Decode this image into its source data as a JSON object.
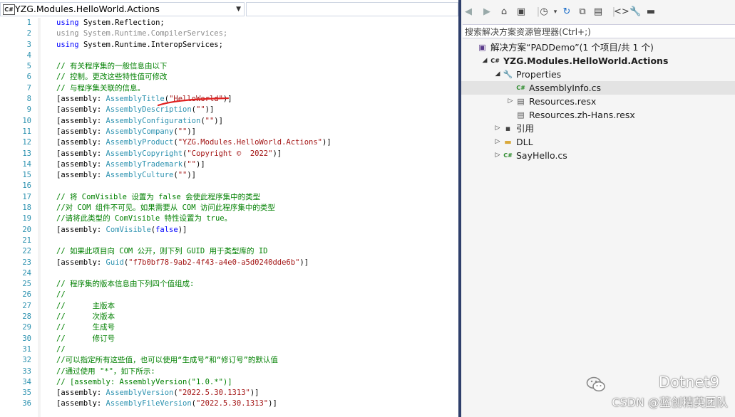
{
  "editor": {
    "type_combo": "YZG.Modules.HelloWorld.Actions",
    "lines": [
      {
        "n": "1",
        "parts": [
          {
            "t": "using ",
            "c": "kw"
          },
          {
            "t": "System.Reflection;",
            "c": ""
          }
        ]
      },
      {
        "n": "2",
        "parts": [
          {
            "t": "using System.Runtime.CompilerServices;",
            "c": "dim"
          }
        ]
      },
      {
        "n": "3",
        "parts": [
          {
            "t": "using ",
            "c": "kw"
          },
          {
            "t": "System.Runtime.InteropServices;",
            "c": ""
          }
        ]
      },
      {
        "n": "4",
        "parts": []
      },
      {
        "n": "5",
        "parts": [
          {
            "t": "// 有关程序集的一般信息由以下",
            "c": "cm"
          }
        ]
      },
      {
        "n": "6",
        "parts": [
          {
            "t": "// 控制。更改这些特性值可修改",
            "c": "cm"
          }
        ]
      },
      {
        "n": "7",
        "parts": [
          {
            "t": "// 与程序集关联的信息。",
            "c": "cm"
          }
        ]
      },
      {
        "n": "8",
        "parts": [
          {
            "t": "[assembly: ",
            "c": ""
          },
          {
            "t": "AssemblyTitle",
            "c": "ty"
          },
          {
            "t": "(",
            "c": ""
          },
          {
            "t": "\"HelloWorld\"",
            "c": "str"
          },
          {
            "t": ")]",
            "c": ""
          }
        ]
      },
      {
        "n": "9",
        "parts": [
          {
            "t": "[assembly: ",
            "c": ""
          },
          {
            "t": "AssemblyDescription",
            "c": "ty"
          },
          {
            "t": "(",
            "c": ""
          },
          {
            "t": "\"\"",
            "c": "str"
          },
          {
            "t": ")]",
            "c": ""
          }
        ]
      },
      {
        "n": "10",
        "parts": [
          {
            "t": "[assembly: ",
            "c": ""
          },
          {
            "t": "AssemblyConfiguration",
            "c": "ty"
          },
          {
            "t": "(",
            "c": ""
          },
          {
            "t": "\"\"",
            "c": "str"
          },
          {
            "t": ")]",
            "c": ""
          }
        ]
      },
      {
        "n": "11",
        "parts": [
          {
            "t": "[assembly: ",
            "c": ""
          },
          {
            "t": "AssemblyCompany",
            "c": "ty"
          },
          {
            "t": "(",
            "c": ""
          },
          {
            "t": "\"\"",
            "c": "str"
          },
          {
            "t": ")]",
            "c": ""
          }
        ]
      },
      {
        "n": "12",
        "parts": [
          {
            "t": "[assembly: ",
            "c": ""
          },
          {
            "t": "AssemblyProduct",
            "c": "ty"
          },
          {
            "t": "(",
            "c": ""
          },
          {
            "t": "\"YZG.Modules.HelloWorld.Actions\"",
            "c": "str"
          },
          {
            "t": ")]",
            "c": ""
          }
        ]
      },
      {
        "n": "13",
        "parts": [
          {
            "t": "[assembly: ",
            "c": ""
          },
          {
            "t": "AssemblyCopyright",
            "c": "ty"
          },
          {
            "t": "(",
            "c": ""
          },
          {
            "t": "\"Copyright ©  2022\"",
            "c": "str"
          },
          {
            "t": ")]",
            "c": ""
          }
        ]
      },
      {
        "n": "14",
        "parts": [
          {
            "t": "[assembly: ",
            "c": ""
          },
          {
            "t": "AssemblyTrademark",
            "c": "ty"
          },
          {
            "t": "(",
            "c": ""
          },
          {
            "t": "\"\"",
            "c": "str"
          },
          {
            "t": ")]",
            "c": ""
          }
        ]
      },
      {
        "n": "15",
        "parts": [
          {
            "t": "[assembly: ",
            "c": ""
          },
          {
            "t": "AssemblyCulture",
            "c": "ty"
          },
          {
            "t": "(",
            "c": ""
          },
          {
            "t": "\"\"",
            "c": "str"
          },
          {
            "t": ")]",
            "c": ""
          }
        ]
      },
      {
        "n": "16",
        "parts": []
      },
      {
        "n": "17",
        "parts": [
          {
            "t": "// 将 ComVisible 设置为 false 会使此程序集中的类型",
            "c": "cm"
          }
        ]
      },
      {
        "n": "18",
        "parts": [
          {
            "t": "//对 COM 组件不可见。如果需要从 COM 访问此程序集中的类型",
            "c": "cm"
          }
        ]
      },
      {
        "n": "19",
        "parts": [
          {
            "t": "//请将此类型的 ComVisible 特性设置为 true。",
            "c": "cm"
          }
        ]
      },
      {
        "n": "20",
        "parts": [
          {
            "t": "[assembly: ",
            "c": ""
          },
          {
            "t": "ComVisible",
            "c": "ty"
          },
          {
            "t": "(",
            "c": ""
          },
          {
            "t": "false",
            "c": "kw"
          },
          {
            "t": ")]",
            "c": ""
          }
        ]
      },
      {
        "n": "21",
        "parts": []
      },
      {
        "n": "22",
        "parts": [
          {
            "t": "// 如果此项目向 COM 公开，则下列 GUID 用于类型库的 ID",
            "c": "cm"
          }
        ]
      },
      {
        "n": "23",
        "parts": [
          {
            "t": "[assembly: ",
            "c": ""
          },
          {
            "t": "Guid",
            "c": "ty"
          },
          {
            "t": "(",
            "c": ""
          },
          {
            "t": "\"f7b0bf78-9ab2-4f43-a4e0-a5d0240dde6b\"",
            "c": "str"
          },
          {
            "t": ")]",
            "c": ""
          }
        ]
      },
      {
        "n": "24",
        "parts": []
      },
      {
        "n": "25",
        "parts": [
          {
            "t": "// 程序集的版本信息由下列四个值组成:",
            "c": "cm"
          }
        ]
      },
      {
        "n": "26",
        "parts": [
          {
            "t": "//",
            "c": "cm"
          }
        ]
      },
      {
        "n": "27",
        "parts": [
          {
            "t": "//      主版本",
            "c": "cm"
          }
        ]
      },
      {
        "n": "28",
        "parts": [
          {
            "t": "//      次版本",
            "c": "cm"
          }
        ]
      },
      {
        "n": "29",
        "parts": [
          {
            "t": "//      生成号",
            "c": "cm"
          }
        ]
      },
      {
        "n": "30",
        "parts": [
          {
            "t": "//      修订号",
            "c": "cm"
          }
        ]
      },
      {
        "n": "31",
        "parts": [
          {
            "t": "//",
            "c": "cm"
          }
        ]
      },
      {
        "n": "32",
        "parts": [
          {
            "t": "//可以指定所有这些值，也可以使用“生成号”和“修订号”的默认值",
            "c": "cm"
          }
        ]
      },
      {
        "n": "33",
        "parts": [
          {
            "t": "//通过使用 \"*\"，如下所示:",
            "c": "cm"
          }
        ]
      },
      {
        "n": "34",
        "parts": [
          {
            "t": "// [assembly: AssemblyVersion(\"1.0.*\")]",
            "c": "cm"
          }
        ]
      },
      {
        "n": "35",
        "parts": [
          {
            "t": "[assembly: ",
            "c": ""
          },
          {
            "t": "AssemblyVersion",
            "c": "ty"
          },
          {
            "t": "(",
            "c": ""
          },
          {
            "t": "\"2022.5.30.1313\"",
            "c": "str"
          },
          {
            "t": ")]",
            "c": ""
          }
        ]
      },
      {
        "n": "36",
        "parts": [
          {
            "t": "[assembly: ",
            "c": ""
          },
          {
            "t": "AssemblyFileVersion",
            "c": "ty"
          },
          {
            "t": "(",
            "c": ""
          },
          {
            "t": "\"2022.5.30.1313\"",
            "c": "str"
          },
          {
            "t": ")]",
            "c": ""
          }
        ]
      }
    ]
  },
  "explorer": {
    "search_placeholder": "搜索解决方案资源管理器(Ctrl+;)",
    "tree": [
      {
        "name": "solution-node",
        "label": "解决方案“PADDemo”(1 个项目/共 1 个)",
        "icon": "solution-icon",
        "expander": "",
        "bold": false,
        "selected": false,
        "indent": 0
      },
      {
        "name": "project-node",
        "label": "YZG.Modules.HelloWorld.Actions",
        "icon": "csharp-project-icon",
        "expander": "▲",
        "bold": true,
        "selected": false,
        "indent": 1
      },
      {
        "name": "properties-node",
        "label": "Properties",
        "icon": "wrench-icon",
        "expander": "▲",
        "bold": false,
        "selected": false,
        "indent": 2
      },
      {
        "name": "assemblyinfo-node",
        "label": "AssemblyInfo.cs",
        "icon": "csharp-file-icon",
        "expander": "",
        "bold": false,
        "selected": true,
        "indent": 3
      },
      {
        "name": "resources-resx-node",
        "label": "Resources.resx",
        "icon": "resource-file-icon",
        "expander": "▷",
        "bold": false,
        "selected": false,
        "indent": 3
      },
      {
        "name": "resources-zh-hans-node",
        "label": "Resources.zh-Hans.resx",
        "icon": "resource-file-icon",
        "expander": "",
        "bold": false,
        "selected": false,
        "indent": 3
      },
      {
        "name": "references-node",
        "label": "引用",
        "icon": "references-icon",
        "expander": "▷",
        "bold": false,
        "selected": false,
        "indent": 2
      },
      {
        "name": "dll-folder-node",
        "label": "DLL",
        "icon": "folder-icon",
        "expander": "▷",
        "bold": false,
        "selected": false,
        "indent": 2
      },
      {
        "name": "sayhello-node",
        "label": "SayHello.cs",
        "icon": "csharp-file-icon",
        "expander": "▷",
        "bold": false,
        "selected": false,
        "indent": 2
      }
    ]
  },
  "watermark": {
    "brand": "Dotnet9",
    "sub": "CSDN @蓝创精英团队"
  },
  "colors": {
    "keyword": "#0000ff",
    "type": "#2b91af",
    "string": "#a31515",
    "comment": "#008000",
    "selection": "#e3e3e3",
    "annotation": "#e0201f"
  }
}
